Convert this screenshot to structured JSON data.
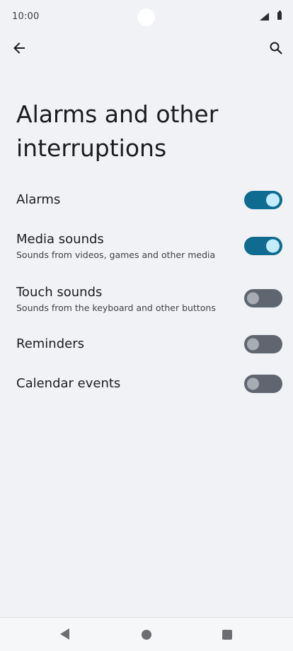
{
  "status": {
    "time": "10:00"
  },
  "toolbar": {
    "back_icon": "arrow-back-icon",
    "search_icon": "search-icon"
  },
  "page": {
    "title": "Alarms and other interruptions"
  },
  "settings": [
    {
      "title": "Alarms",
      "subtitle": "",
      "enabled": true
    },
    {
      "title": "Media sounds",
      "subtitle": "Sounds from videos, games and other media",
      "enabled": true
    },
    {
      "title": "Touch sounds",
      "subtitle": "Sounds from the keyboard and other buttons",
      "enabled": false
    },
    {
      "title": "Reminders",
      "subtitle": "",
      "enabled": false
    },
    {
      "title": "Calendar events",
      "subtitle": "",
      "enabled": false
    }
  ],
  "colors": {
    "switch_on": "#0f6b8f",
    "switch_off": "#5f6670",
    "background": "#f0f2f5"
  }
}
